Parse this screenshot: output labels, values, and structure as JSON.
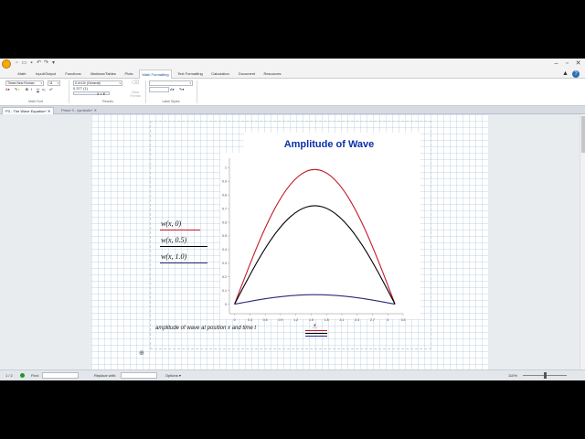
{
  "ribbon": {
    "tabs": [
      "Math",
      "Input/Output",
      "Functions",
      "Matrices/Tables",
      "Plots",
      "Math Formatting",
      "Text Formatting",
      "Calculation",
      "Document",
      "Resources"
    ],
    "active_tab": "Math Formatting",
    "font_name": "Times New Roman",
    "font_size": "11",
    "format_value": "0.4×10³ (General)",
    "format_sample": "0.377 (1)",
    "format_sample2": "3 × E",
    "clear_format": "Clear Format",
    "groups": {
      "math_font": "Math Font",
      "results": "Results",
      "label_styles": "Label Styles"
    }
  },
  "doc_tabs": [
    {
      "label": "P3 - The Wave Equation*",
      "active": true
    },
    {
      "label": "Prime 9 - symbolic*",
      "active": false
    }
  ],
  "worksheet": {
    "expressions": [
      "w(x, 0)",
      "w(x, 0.5)",
      "w(x, 1.0)"
    ],
    "caption": "amplitude of wave at position x and time t"
  },
  "status": {
    "page": "1 / 2",
    "find_label": "Find:",
    "replace_label": "Replace with:",
    "options_label": "Options",
    "zoom": "110%"
  },
  "colors": {
    "red": "#c0182a",
    "black": "#000000",
    "navy": "#2a2a7a",
    "title_blue": "#0b2fa8"
  },
  "chart_data": {
    "type": "line",
    "title": "Amplitude of Wave",
    "xlabel": "x",
    "ylabel": "",
    "xlim": [
      -0.1,
      3.3
    ],
    "ylim": [
      -0.07,
      1.07
    ],
    "x_ticks": [
      0,
      0.3,
      0.6,
      0.9,
      1.2,
      1.5,
      1.8,
      2.1,
      2.4,
      2.7,
      3,
      3.3
    ],
    "x_tick_labels": [
      "0",
      "0.3",
      "0.6",
      "0.9",
      "1.2",
      "1.5",
      "1.8",
      "2.1",
      "2.4",
      "2.7",
      "3",
      "3.3"
    ],
    "y_ticks": [
      0,
      0.1,
      0.2,
      0.3,
      0.4,
      0.5,
      0.6,
      0.7,
      0.8,
      0.9,
      1
    ],
    "y_tick_labels": [
      "0",
      "0.1",
      "0.2",
      "0.3",
      "0.4",
      "0.5",
      "0.6",
      "0.7",
      "0.8",
      "0.9",
      "1"
    ],
    "grid": false,
    "series": [
      {
        "color": "#c0182a",
        "x": [
          0,
          0.314,
          0.628,
          0.942,
          1.257,
          1.571,
          1.885,
          2.199,
          2.513,
          2.827,
          3.142
        ],
        "y": [
          0,
          0.309,
          0.588,
          0.809,
          0.951,
          1.0,
          0.951,
          0.809,
          0.588,
          0.309,
          0
        ]
      },
      {
        "color": "#000000",
        "x": [
          0,
          0.314,
          0.628,
          0.942,
          1.257,
          1.571,
          1.885,
          2.199,
          2.513,
          2.827,
          3.142
        ],
        "y": [
          0,
          0.226,
          0.43,
          0.591,
          0.695,
          0.731,
          0.695,
          0.591,
          0.43,
          0.226,
          0
        ]
      },
      {
        "color": "#2a2a7a",
        "x": [
          0,
          0.314,
          0.628,
          0.942,
          1.257,
          1.571,
          1.885,
          2.199,
          2.513,
          2.827,
          3.142
        ],
        "y": [
          0,
          0.022,
          0.042,
          0.057,
          0.067,
          0.07,
          0.067,
          0.057,
          0.042,
          0.022,
          0
        ]
      }
    ]
  }
}
